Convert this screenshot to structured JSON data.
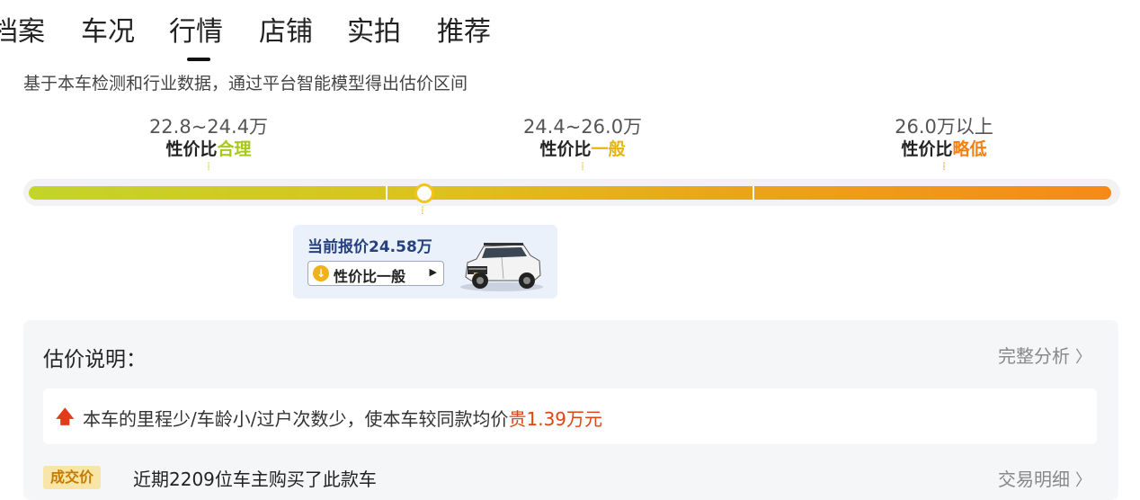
{
  "tabs": [
    {
      "label": "档案"
    },
    {
      "label": "车况"
    },
    {
      "label": "行情"
    },
    {
      "label": "店铺"
    },
    {
      "label": "实拍"
    },
    {
      "label": "推荐"
    }
  ],
  "active_tab": "行情",
  "subtitle": "基于本车检测和行业数据，通过平台智能模型得出估价区间",
  "ranges": [
    {
      "price": "22.8~24.4万",
      "level_prefix": "性价比",
      "level_value": "合理",
      "color": "#a8c81a"
    },
    {
      "price": "24.4~26.0万",
      "level_prefix": "性价比",
      "level_value": "一般",
      "color": "#e7b40e"
    },
    {
      "price": "26.0万以上",
      "level_prefix": "性价比",
      "level_value": "略低",
      "color": "#f57f0f"
    }
  ],
  "current_quote": {
    "text": "当前报价24.58万",
    "badge_label": "性价比一般",
    "badge_icon": "arrow-down-circle-icon",
    "car_image": "car-thumbnail"
  },
  "estimate": {
    "title": "估价说明：",
    "link_label": "完整分析",
    "note_prefix": "本车的里程少/车龄小/过户次数少，使本车较同款均价",
    "note_highlight": "贵1.39万元"
  },
  "deal": {
    "tag_label": "成交价",
    "text": "近期2209位车主购买了此款车",
    "link_label": "交易明细"
  },
  "colors": {
    "green": "#a8c81a",
    "yellow": "#e7b40e",
    "orange": "#f57f0f",
    "highlight_red": "#e04412",
    "quote_navy": "#25407e"
  }
}
